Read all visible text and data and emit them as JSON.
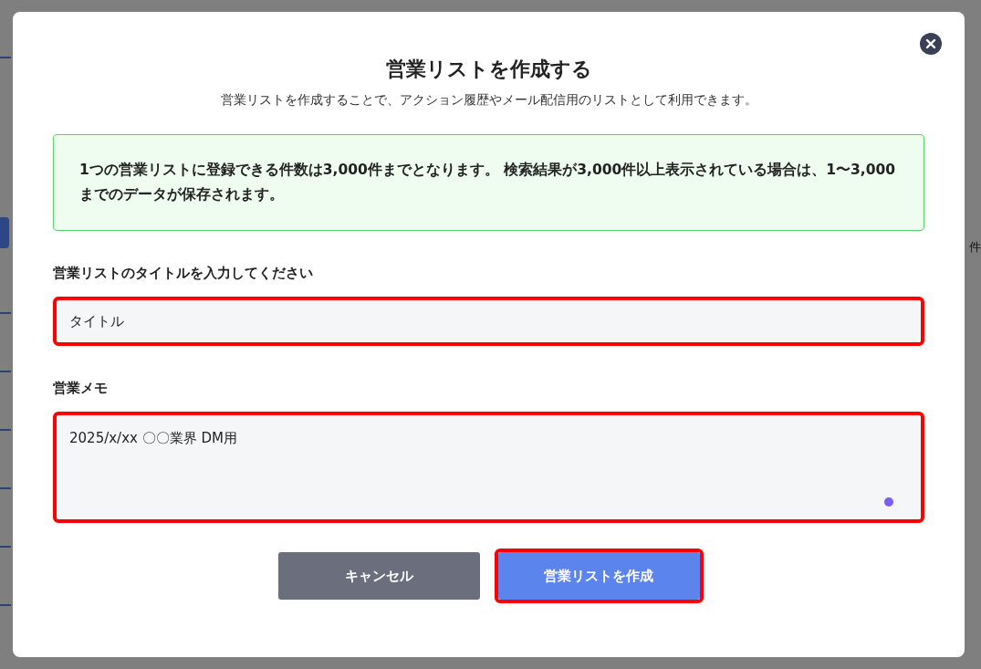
{
  "background": {
    "count_fragment": "件"
  },
  "dialog": {
    "title": "営業リストを作成する",
    "subtitle": "営業リストを作成することで、アクション履歴やメール配信用のリストとして利用できます。",
    "notice": "1つの営業リストに登録できる件数は3,000件までとなります。 検索結果が3,000件以上表示されている場合は、1〜3,000までのデータが保存されます。",
    "fields": [
      {
        "kind": "input",
        "label": "営業リストのタイトルを入力してください",
        "value": "タイトル",
        "highlighted": true
      },
      {
        "kind": "textarea",
        "label": "営業メモ",
        "value": "2025/x/xx 〇〇業界 DM用",
        "highlighted": true
      }
    ],
    "buttons": [
      {
        "kind": "cancel",
        "label": "キャンセル",
        "highlighted": false
      },
      {
        "kind": "primary",
        "label": "営業リストを作成",
        "highlighted": true
      }
    ]
  }
}
